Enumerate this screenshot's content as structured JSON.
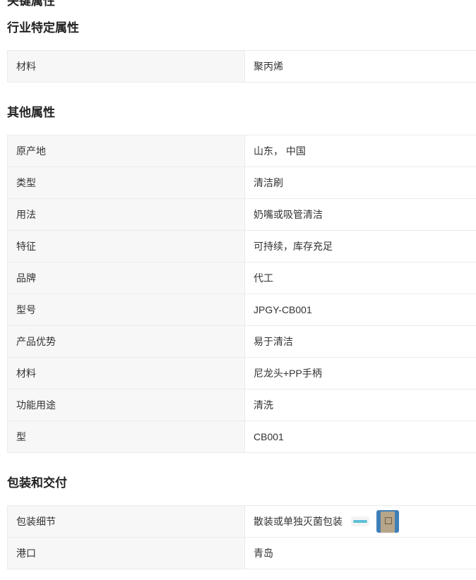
{
  "sections": [
    {
      "title": "行业特定属性",
      "rows": [
        {
          "key": "材料",
          "value": "聚丙烯"
        }
      ]
    },
    {
      "title": "其他属性",
      "rows": [
        {
          "key": "原产地",
          "value": "山东， 中国"
        },
        {
          "key": "类型",
          "value": "清洁刷"
        },
        {
          "key": "用法",
          "value": "奶嘴或吸管清洁"
        },
        {
          "key": "特征",
          "value": "可持续，库存充足"
        },
        {
          "key": "品牌",
          "value": "代工"
        },
        {
          "key": "型号",
          "value": "JPGY-CB001"
        },
        {
          "key": "产品优势",
          "value": "易于清洁"
        },
        {
          "key": "材料",
          "value": "尼龙头+PP手柄"
        },
        {
          "key": "功能用途",
          "value": "清洗"
        },
        {
          "key": "型",
          "value": "CB001"
        }
      ]
    },
    {
      "title": "包装和交付",
      "rows": [
        {
          "key": "包装细节",
          "value": "散装或单独灭菌包装"
        },
        {
          "key": "港口",
          "value": "青岛"
        }
      ]
    }
  ]
}
